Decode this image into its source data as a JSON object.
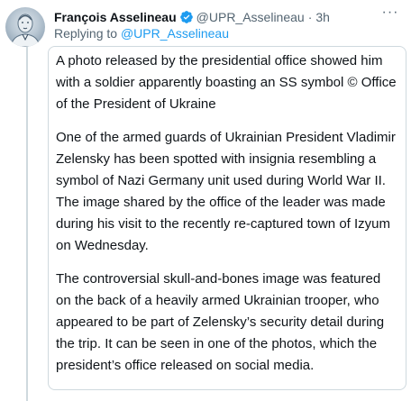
{
  "author": {
    "name": "François Asselineau",
    "handle": "@UPR_Asselineau",
    "time": "3h",
    "separator": "·",
    "verified_color": "#1d9bf0"
  },
  "reply": {
    "prefix": "Replying to",
    "mention": "@UPR_Asselineau"
  },
  "menu": {
    "icon": "more-horizontal-icon",
    "label": "···"
  },
  "body": {
    "paragraphs": [
      "A photo released by the presidential office showed him with a soldier apparently boasting an SS symbol © Office of the President of Ukraine",
      "One of the armed guards of Ukrainian President Vladimir Zelensky has been spotted with insignia resembling a symbol of Nazi Germany unit used during World War II. The image shared by the office of the leader was made during his visit to the recently re-captured town of Izyum on Wednesday.",
      "The controversial skull-and-bones image was featured on the back of a heavily armed Ukrainian trooper, who appeared to be part of Zelensky’s security detail during the trip. It can be seen in one of the photos, which the president’s office released on social media."
    ]
  },
  "colors": {
    "text": "#0f1419",
    "secondary": "#536471",
    "link": "#1d9bf0",
    "border": "#cfd9de"
  }
}
